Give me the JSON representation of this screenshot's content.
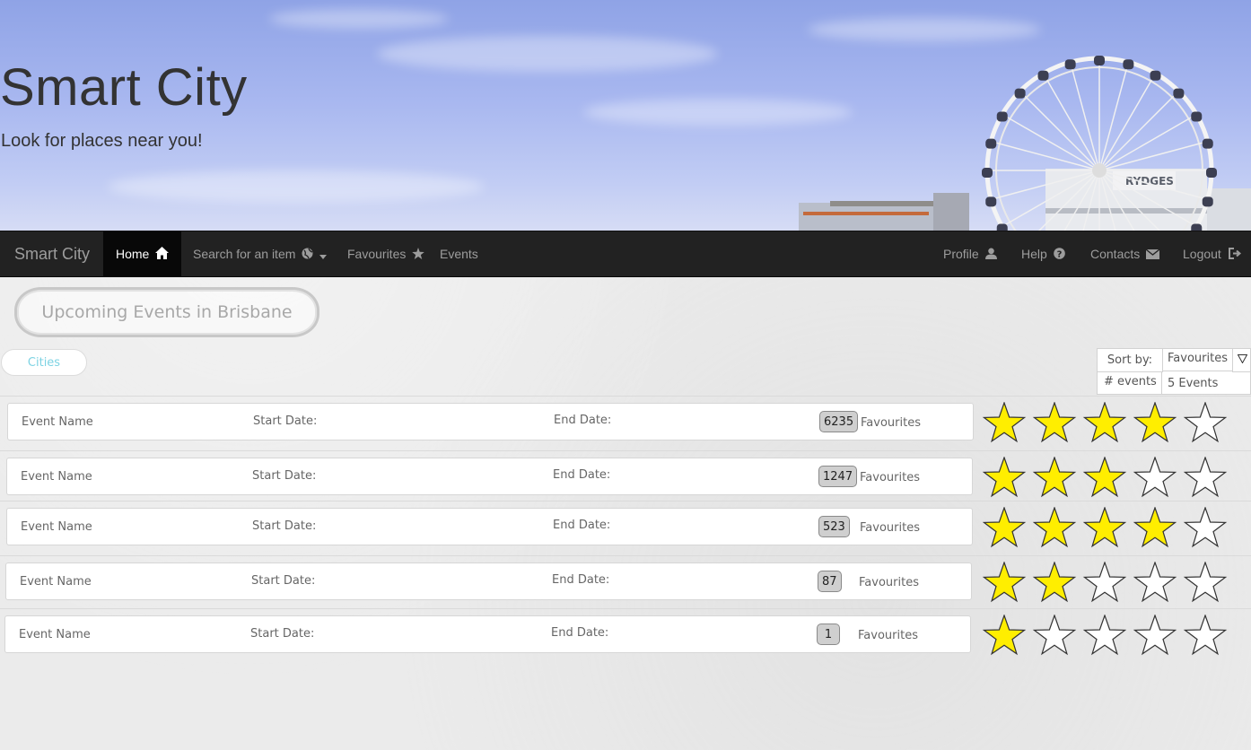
{
  "header": {
    "title": "Smart City",
    "tagline": "Look for places near you!"
  },
  "navbar": {
    "brand": "Smart City",
    "left_items": [
      {
        "label": "Home",
        "icon": "home-icon",
        "active": true
      },
      {
        "label": "Search for an item",
        "icon": "globe-icon",
        "dropdown": true
      },
      {
        "label": "Favourites",
        "icon": "star-icon"
      },
      {
        "label": "Events"
      }
    ],
    "right_items": [
      {
        "label": "Profile",
        "icon": "user-icon"
      },
      {
        "label": "Help",
        "icon": "question-circle-icon"
      },
      {
        "label": "Contacts",
        "icon": "envelope-icon"
      },
      {
        "label": "Logout",
        "icon": "logout-icon"
      }
    ]
  },
  "page": {
    "heading": "Upcoming Events in Brisbane",
    "cities_tab": "Cities"
  },
  "sort": {
    "label": "Sort by:",
    "selected": "Favourites",
    "count_label": "# events",
    "count_value": "5 Events"
  },
  "events": [
    {
      "name_label": "Event Name",
      "start_label": "Start Date:",
      "end_label": "End Date:",
      "favourites": "6235",
      "favourites_label": "Favourites",
      "rating": 4
    },
    {
      "name_label": "Event Name",
      "start_label": "Start Date:",
      "end_label": "End Date:",
      "favourites": "1247",
      "favourites_label": "Favourites",
      "rating": 3
    },
    {
      "name_label": "Event Name",
      "start_label": "Start Date:",
      "end_label": "End Date:",
      "favourites": "523",
      "favourites_label": "Favourites",
      "rating": 4
    },
    {
      "name_label": "Event Name",
      "start_label": "Start Date:",
      "end_label": "End Date:",
      "favourites": "87",
      "favourites_label": "Favourites",
      "rating": 2
    },
    {
      "name_label": "Event Name",
      "start_label": "Start Date:",
      "end_label": "End Date:",
      "favourites": "1",
      "favourites_label": "Favourites",
      "rating": 1
    }
  ],
  "rating_max": 5,
  "colors": {
    "navbar_bg": "#222222",
    "nav_text": "#9d9d9d",
    "star_fill": "#ffee00",
    "star_empty": "#ffffff",
    "cities_text": "#7dd3e3"
  },
  "banner_sign": "RYDGES"
}
